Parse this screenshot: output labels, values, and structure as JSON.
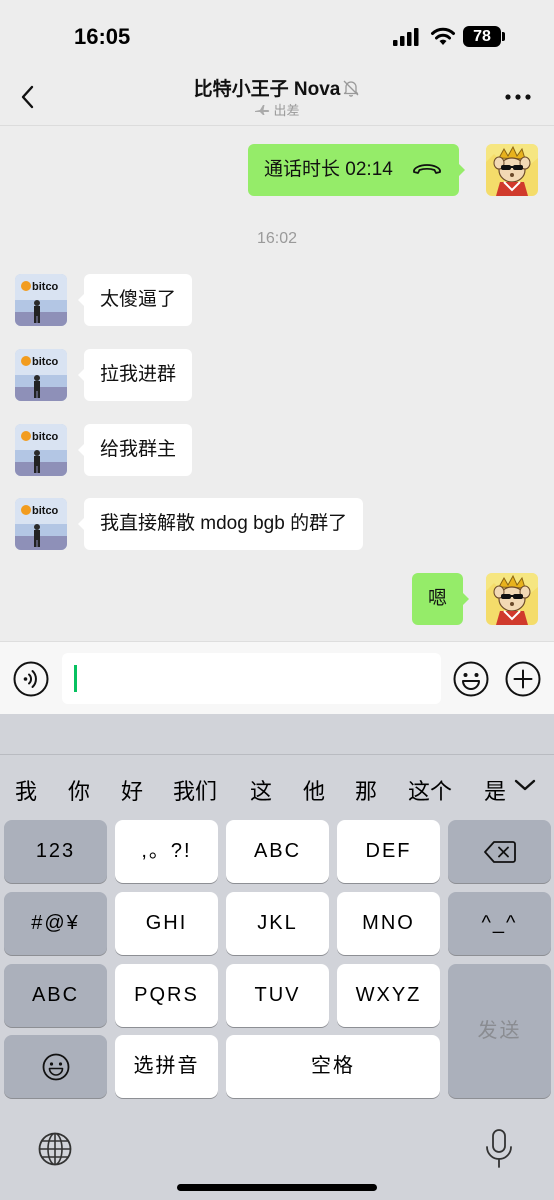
{
  "status_bar": {
    "time": "16:05",
    "battery": "78",
    "icons": [
      "signal-icon",
      "wifi-icon",
      "battery-icon"
    ]
  },
  "nav": {
    "title": "比特小王子 Nova",
    "subtitle": "出差",
    "icons": [
      "back-icon",
      "mute-icon",
      "plane-icon",
      "more-icon"
    ]
  },
  "chat": {
    "time_divider": "16:02",
    "messages": [
      {
        "side": "out",
        "text": "通话时长 02:14",
        "icon": "call-hangup-icon"
      },
      {
        "side": "in",
        "text": "太傻逼了"
      },
      {
        "side": "in",
        "text": "拉我进群"
      },
      {
        "side": "in",
        "text": "给我群主"
      },
      {
        "side": "in",
        "text": "我直接解散 mdog bgb 的群了"
      },
      {
        "side": "out",
        "text": "嗯"
      }
    ],
    "colors": {
      "out_bubble": "#95ec69",
      "in_bubble": "#ffffff",
      "cursor": "#07c160"
    }
  },
  "input_bar": {
    "icons": [
      "voice-icon",
      "emoji-icon",
      "plus-icon"
    ]
  },
  "keyboard": {
    "candidates": [
      "我",
      "你",
      "好",
      "我们",
      "这",
      "他",
      "那",
      "这个",
      "是"
    ],
    "keys": {
      "num": "123",
      "punct": ",。?!",
      "abc": "ABC",
      "def": "DEF",
      "symbols": "#@¥",
      "ghi": "GHI",
      "jkl": "JKL",
      "mno": "MNO",
      "face": "^_^",
      "abc_switch": "ABC",
      "pqrs": "PQRS",
      "tuv": "TUV",
      "wxyz": "WXYZ",
      "send": "发送",
      "pinyin": "选拼音",
      "space": "空格"
    },
    "icons": [
      "backspace-icon",
      "emoji-key-icon",
      "globe-icon",
      "mic-icon",
      "collapse-icon"
    ]
  }
}
